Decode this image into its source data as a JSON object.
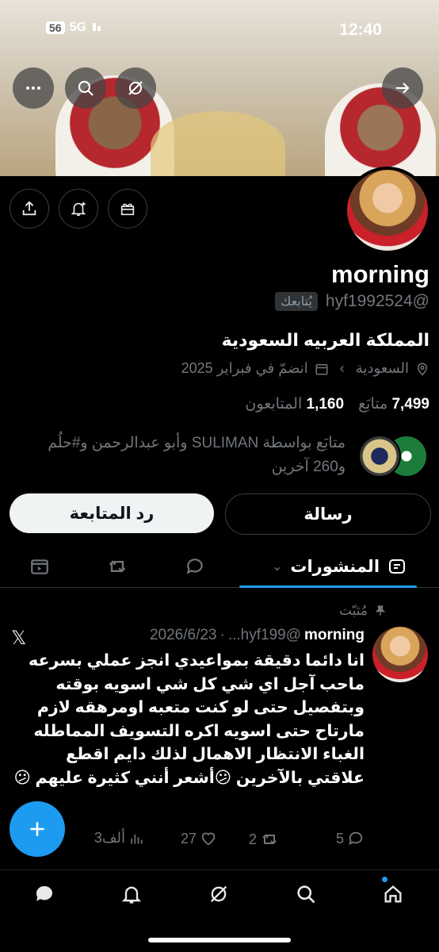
{
  "status_bar": {
    "time": "12:40",
    "network": "5G",
    "signal_badge": "56"
  },
  "profile": {
    "name": "morning",
    "handle": "@hyf1992524",
    "follows_you": "يُتابعك",
    "bio": "المملكة العربيه السعودية",
    "location": "السعودية",
    "joined": "انضمّ في فبراير 2025",
    "following_count": "7,499",
    "following_label": "متابَع",
    "followers_count": "1,160",
    "followers_label": "المتابعون",
    "followed_by": "متابَع بواسطة SULIMAN وأبو عبدالرحمن و#حلُم و260 آخرين"
  },
  "buttons": {
    "follow_back": "رد المتابعة",
    "message": "رسالة"
  },
  "tabs": {
    "posts": "المنشورات"
  },
  "tweet": {
    "pinned_label": "مُثبّت",
    "author_name": "morning",
    "author_handle": "@hyf199...",
    "date": "2026/6/23",
    "separator": "·",
    "text": "انا دائما دقيقة بمواعيدي انجز عملي بسرعه ماحب آجل اي شي كل شي اسويه بوقته وبتفصيل حتى لو كنت متعبه اومرهقه لازم مارتاح حتى اسويه اكره التسويف المماطله الغباء الانتظار الاهمال لذلك دايم اقطع علاقتي بالآخرين 😕أشعر أنني كثيرة عليهم 😕",
    "replies": "5",
    "retweets": "2",
    "likes": "27",
    "views": "3ألف"
  },
  "colors": {
    "accent": "#1d9bf0",
    "background": "#000000",
    "text": "#e7e9ea",
    "muted": "#71767b"
  }
}
